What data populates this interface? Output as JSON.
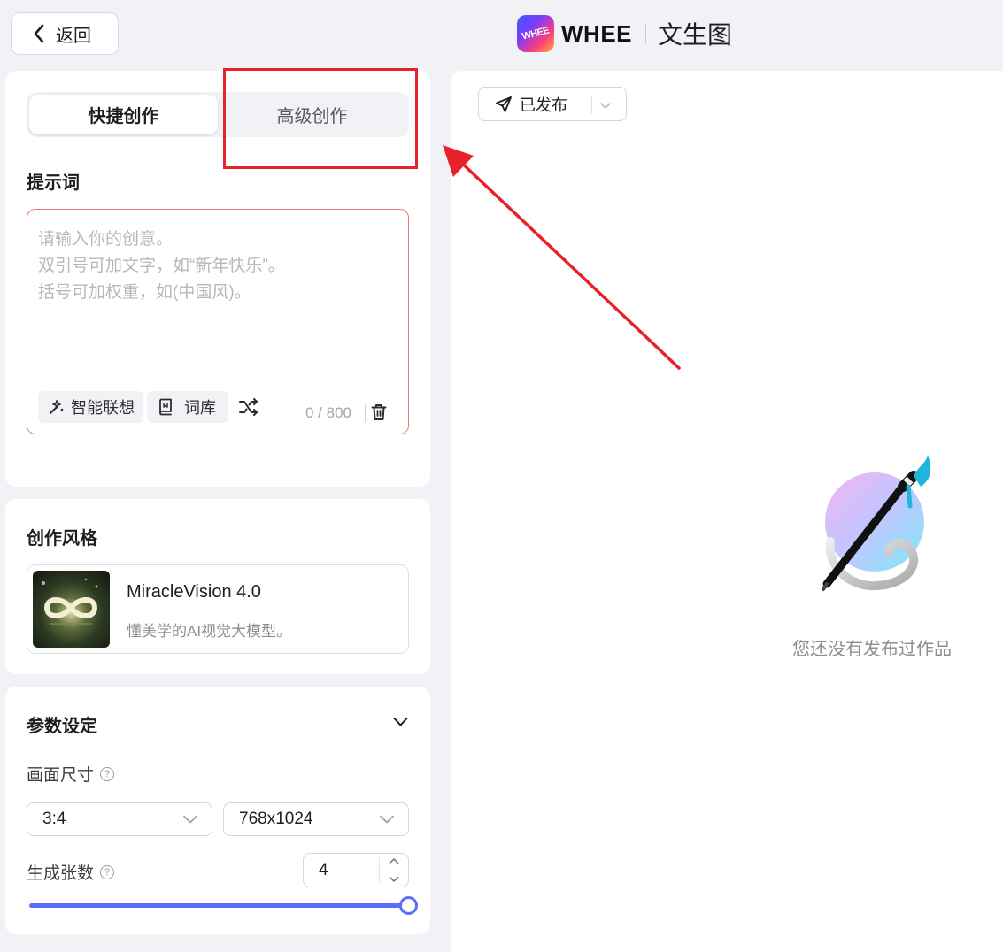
{
  "header": {
    "back_label": "返回",
    "brand": "WHEE",
    "logo_mark_text": "WHEE",
    "title": "文生图"
  },
  "tabs": [
    {
      "label": "快捷创作",
      "active": true
    },
    {
      "label": "高级创作",
      "active": false
    }
  ],
  "prompt": {
    "section_label": "提示词",
    "placeholder_lines": [
      "请输入你的创意。",
      "双引号可加文字，如“新年快乐”。",
      "括号可加权重，如(中国风)。"
    ],
    "value": "",
    "smart_assoc_label": "智能联想",
    "lexicon_label": "词库",
    "char_count": "0 / 800"
  },
  "style": {
    "section_label": "创作风格",
    "name": "MiracleVision 4.0",
    "desc": "懂美学的AI视觉大模型。"
  },
  "params": {
    "section_label": "参数设定",
    "size_label": "画面尺寸",
    "ratio_value": "3:4",
    "resolution_value": "768x1024",
    "count_label": "生成张数",
    "count_value": "4",
    "count_slider_fraction": 1.0
  },
  "right": {
    "filter_label": "已发布",
    "empty_text": "您还没有发布过作品"
  },
  "colors": {
    "accent": "#5b6cf9",
    "annotation_red": "#e8222a",
    "prompt_border": "#f07a7a"
  }
}
